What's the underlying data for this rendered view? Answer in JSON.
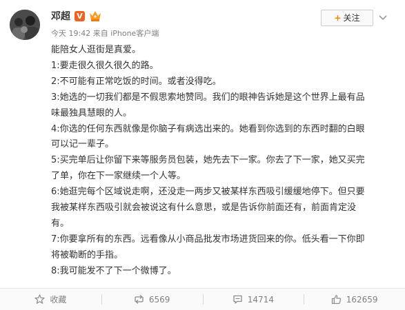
{
  "post": {
    "author": "邓超",
    "verified_badge": "V",
    "meta_time": "今天 19:42",
    "meta_from": "来自 iPhone客户端",
    "lines": [
      "能陪女人逛街是真爱。",
      "1:要走很久很久很久的路。",
      "2:不可能有正常吃饭的时间。或者没得吃。",
      "3:她选的一切我们都是不假思索地赞同。我们的眼神告诉她是这个世界上最有品",
      "味最独具慧眼的人。",
      "4:你选的任何东西就像是你脑子有病选出来的。她看到你选到的东西时翻的白眼",
      "可以记一辈子。",
      "5:买完单后让你留下来等服务员包装，她先去下一家。你去了下一家，她又买完",
      "了单，你在下一家继续一个人等。",
      "6:她逛完每个区域说走啊，还没走一两步又被某样东西吸引缓缓地停下。但只要",
      "我被某样东西吸引就会被说这有什么意思，或是告诉你前面还有，前面肯定没",
      "有。",
      "7:你要拿所有的东西。远看像从小商品批发市场进货回来的你。低头看一下你即",
      "将被勒断的手指。",
      "8:我可能发不了下一个微博了。"
    ]
  },
  "actions": {
    "follow_label": "关注",
    "follow_plus": "+",
    "collect_label": "收藏",
    "repost_count": "6569",
    "comment_count": "14714",
    "like_count": "162659"
  },
  "icons": {
    "verified": "verified-v-icon",
    "vip": "vip-crown-icon",
    "more": "chevron-down-icon",
    "collect": "star-icon",
    "repost": "repost-icon",
    "comment": "comment-icon",
    "like": "thumbs-up-icon"
  },
  "colors": {
    "accent": "#ff8200",
    "verified": "#f0621f",
    "text": "#333333",
    "muted": "#808080"
  }
}
